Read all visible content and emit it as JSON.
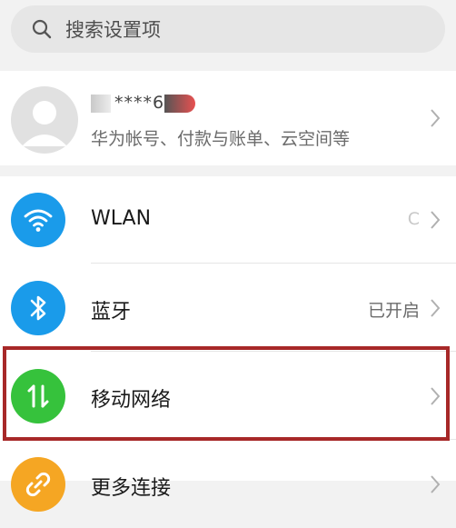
{
  "search": {
    "placeholder": "搜索设置项"
  },
  "account": {
    "name_masked": "****6",
    "subtitle": "华为帐号、付款与账单、云空间等"
  },
  "settings": [
    {
      "label": "WLAN",
      "status": "C",
      "icon": "wifi-icon",
      "color": "#1a9bea"
    },
    {
      "label": "蓝牙",
      "status": "已开启",
      "icon": "bluetooth-icon",
      "color": "#1a9bea"
    },
    {
      "label": "移动网络",
      "status": "",
      "icon": "mobile-data-icon",
      "color": "#36c23c"
    },
    {
      "label": "更多连接",
      "status": "",
      "icon": "link-icon",
      "color": "#f5a623"
    }
  ],
  "colors": {
    "highlight": "#a72828"
  }
}
